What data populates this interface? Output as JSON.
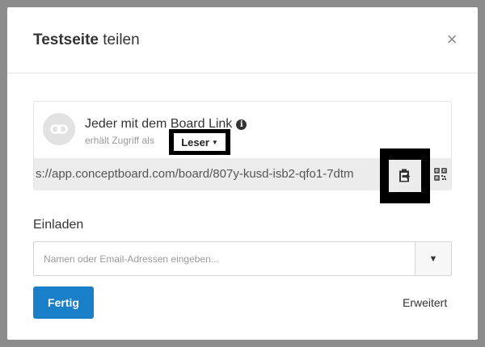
{
  "dialog": {
    "title_bold": "Testseite",
    "title_rest": " teilen",
    "close_symbol": "×"
  },
  "link_share": {
    "title": "Jeder mit dem Board Link",
    "info_symbol": "i",
    "subtitle": "erhält Zugriff als",
    "role": "Leser",
    "role_caret": "▼",
    "url": "s://app.conceptboard.com/board/807y-kusd-isb2-qfo1-7dtm"
  },
  "invite": {
    "label": "Einladen",
    "placeholder": "Namen oder Email-Adressen eingeben...",
    "dropdown_symbol": "▼"
  },
  "footer": {
    "done_label": "Fertig",
    "advanced_label": "Erweitert"
  },
  "colors": {
    "primary": "#1a7fc9",
    "backdrop": "#8c8c8c"
  }
}
